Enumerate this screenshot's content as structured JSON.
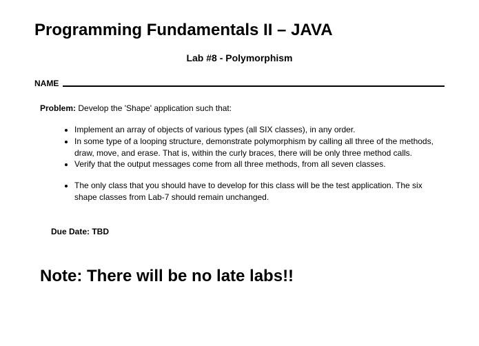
{
  "title": "Programming Fundamentals II – JAVA",
  "subtitle": "Lab #8 - Polymorphism",
  "name_label": "NAME",
  "problem_label": "Problem:",
  "problem_text": "  Develop the 'Shape' application such that:",
  "bullets_a": [
    "Implement an array of objects of various types (all SIX classes), in any order.",
    "In some type of a looping structure, demonstrate polymorphism by calling all three of the methods, draw, move, and erase.  That is, within the curly braces, there will be only three method calls.",
    "Verify that the output messages come from all three methods, from all seven classes."
  ],
  "bullets_b": [
    "The only class that you should have to develop for this class will be the test application.  The six shape classes from Lab-7 should remain unchanged."
  ],
  "due_date": "Due Date:  TBD",
  "note": "Note:  There will be no late labs!!"
}
